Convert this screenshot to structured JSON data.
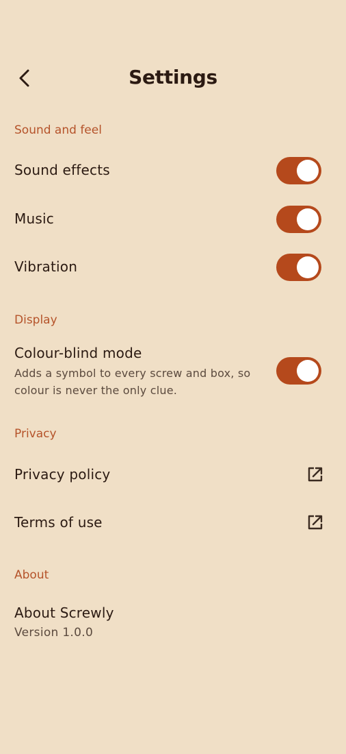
{
  "header": {
    "title": "Settings",
    "back_icon": "chevron-left-icon"
  },
  "sections": {
    "sound": {
      "label": "Sound and feel",
      "sound_effects": {
        "label": "Sound effects",
        "on": true
      },
      "music": {
        "label": "Music",
        "on": true
      },
      "vibration": {
        "label": "Vibration",
        "on": true
      }
    },
    "display": {
      "label": "Display",
      "colour_blind": {
        "label": "Colour-blind mode",
        "description": "Adds a symbol to every screw and box, so colour is never the only clue.",
        "on": true
      }
    },
    "privacy": {
      "label": "Privacy",
      "privacy_policy": {
        "label": "Privacy policy",
        "icon": "external-link-icon"
      },
      "terms": {
        "label": "Terms of use",
        "icon": "external-link-icon"
      }
    },
    "about": {
      "label": "About",
      "about_app": {
        "label": "About Screwly",
        "version": "Version 1.0.0"
      }
    }
  },
  "colors": {
    "background": "#f0dfc6",
    "accent": "#b5491c",
    "section_label": "#b5532a",
    "text": "#2b1a12",
    "secondary_text": "#5b4a3e"
  }
}
